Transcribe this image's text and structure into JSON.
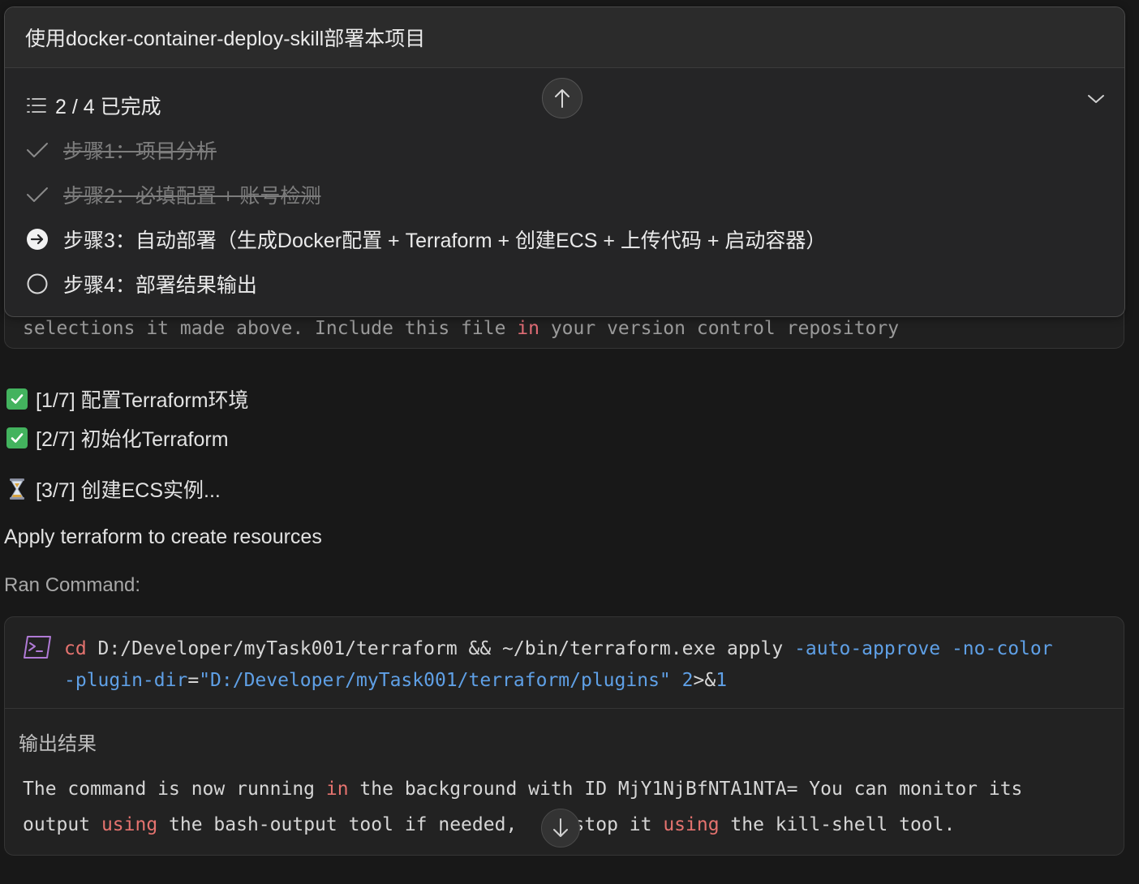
{
  "task": {
    "title": "使用docker-container-deploy-skill部署本项目",
    "progress_text": "2 / 4 已完成",
    "steps": [
      {
        "label": "步骤1：项目分析",
        "status": "done"
      },
      {
        "label": "步骤2：必填配置 + 账号检测",
        "status": "done"
      },
      {
        "label": "步骤3：自动部署（生成Docker配置 + Terraform + 创建ECS + 上传代码 + 启动容器）",
        "status": "in_progress"
      },
      {
        "label": "步骤4：部署结果输出",
        "status": "pending"
      }
    ]
  },
  "previous_output": {
    "line_before": "selections it made above. Include this file ",
    "keyword": "in",
    "line_after": " your version control repository"
  },
  "progress_items": [
    {
      "icon": "check-box",
      "text": "[1/7] 配置Terraform环境"
    },
    {
      "icon": "check-box",
      "text": "[2/7] 初始化Terraform"
    },
    {
      "icon": "hourglass",
      "text": "[3/7] 创建ECS实例..."
    }
  ],
  "message": "Apply terraform to create resources",
  "ran_command_label": "Ran Command:",
  "command": {
    "cd": "cd",
    "path": " D:/Developer/myTask001/terraform && ~/bin/terraform.exe apply ",
    "flag1": "-auto-approve",
    "flag2": "-no-color",
    "flag3": "-plugin-dir",
    "eq": "=",
    "plugin_path": "\"D:/Developer/myTask001/terraform/plugins\"",
    "redirect_num": "2",
    "redirect_op": ">&",
    "redirect_target": "1"
  },
  "output": {
    "label": "输出结果",
    "p1": "The command is now running ",
    "k1": "in",
    "p2": " the background with ID MjY1NjBfNTA1NTA= You can monitor its\noutput ",
    "k2": "using",
    "p3": " the bash-output tool if needed,     stop it ",
    "k3": "using",
    "p4": " the kill-shell tool."
  },
  "colors": {
    "background": "#181818",
    "keyword": "#e5736f",
    "flag": "#5fa0e6",
    "checkbox": "#43b35e",
    "terminal_icon": "#b07ad6"
  }
}
